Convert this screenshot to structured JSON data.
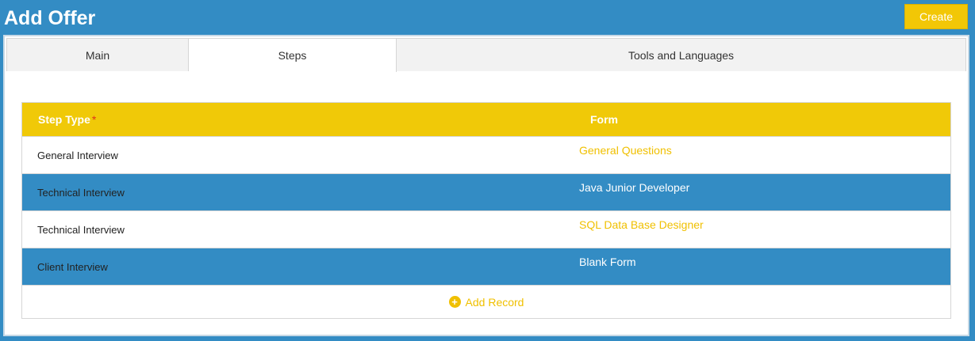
{
  "header": {
    "title": "Add Offer",
    "create_label": "Create"
  },
  "tabs": [
    {
      "label": "Main",
      "active": false
    },
    {
      "label": "Steps",
      "active": true
    },
    {
      "label": "Tools and Languages",
      "active": false
    }
  ],
  "grid": {
    "columns": {
      "step_type": "Step Type",
      "required_marker": "*",
      "form": "Form"
    },
    "rows": [
      {
        "step_type": "General Interview",
        "form": "General Questions"
      },
      {
        "step_type": "Technical Interview",
        "form": "Java Junior Developer"
      },
      {
        "step_type": "Technical Interview",
        "form": "SQL Data Base Designer"
      },
      {
        "step_type": "Client Interview",
        "form": "Blank Form"
      }
    ],
    "add_record_label": "Add Record",
    "add_record_icon": "plus-circle-icon"
  },
  "colors": {
    "background": "#338cc4",
    "accent": "#f0c908",
    "selected_row": "#338cc4"
  }
}
